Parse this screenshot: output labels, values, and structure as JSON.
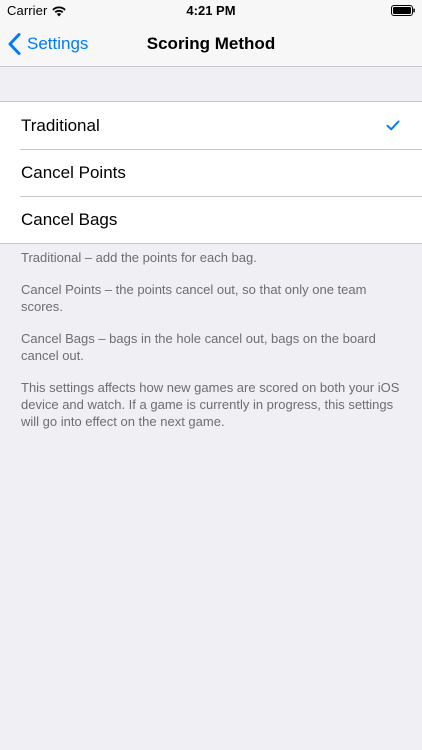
{
  "status_bar": {
    "carrier": "Carrier",
    "time": "4:21 PM",
    "wifi_icon": "wifi-icon",
    "battery_icon": "battery-icon"
  },
  "nav": {
    "back_label": "Settings",
    "back_icon": "chevron-left-icon",
    "title": "Scoring Method"
  },
  "options": [
    {
      "label": "Traditional",
      "selected": true
    },
    {
      "label": "Cancel Points",
      "selected": false
    },
    {
      "label": "Cancel Bags",
      "selected": false
    }
  ],
  "footer": {
    "traditional": "Traditional – add the points for each bag.",
    "cancel_points": "Cancel Points – the points cancel out, so that only one team scores.",
    "cancel_bags": "Cancel Bags – bags in the hole cancel out, bags on the board cancel out.",
    "note": "This settings affects how new games are scored on both your iOS device and watch. If a game is currently in progress, this settings will go into effect on the next game."
  },
  "colors": {
    "accent": "#007aff",
    "background": "#efeff4",
    "footer_text": "#6d6d72"
  }
}
